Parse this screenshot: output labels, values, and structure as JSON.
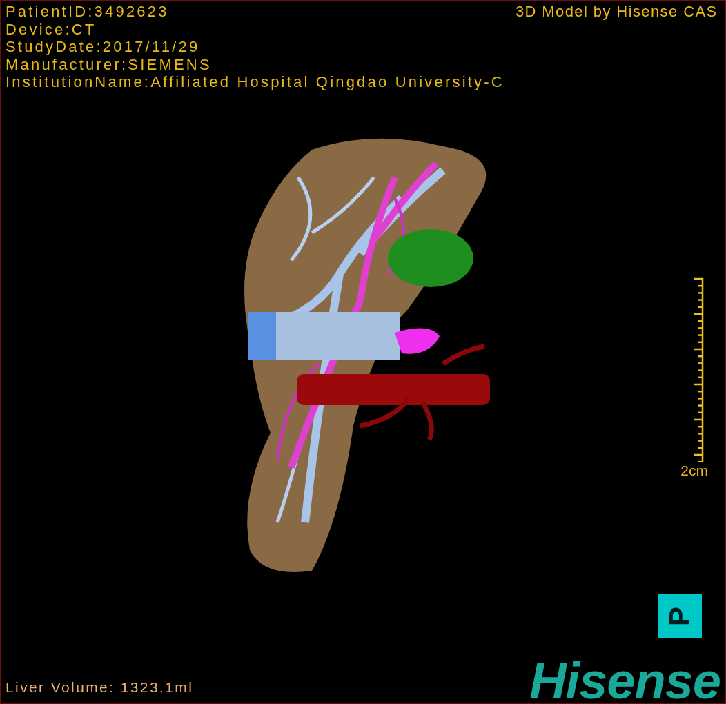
{
  "info_lines": [
    "PatientID:3492623",
    "Device:CT",
    "StudyDate:2017/11/29",
    "Manufacturer:SIEMENS",
    "InstitutionName:Affiliated Hospital Qingdao University-C"
  ],
  "title": "3D Model by Hisense CAS",
  "scale_bar": {
    "label": "2cm"
  },
  "orientation": {
    "label": "P"
  },
  "liver_volume": "Liver Volume: 1323.1ml",
  "logo": "Hisense"
}
